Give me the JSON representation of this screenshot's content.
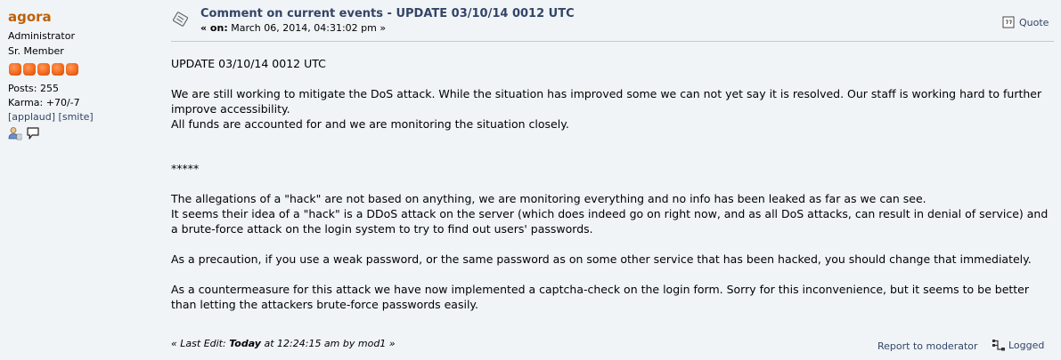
{
  "poster": {
    "name": "agora",
    "title": "Administrator",
    "rank": "Sr. Member",
    "star_count": 5,
    "star_color": "#f26a1d",
    "posts": "Posts: 255",
    "karma": "Karma: +70/-7",
    "applaud": "[applaud]",
    "smite": "[smite]",
    "icons": [
      "profile-icon",
      "personal-message-icon"
    ]
  },
  "post": {
    "subject": "Comment on current events - UPDATE 03/10/14 0012 UTC",
    "date_prefix": "« on:",
    "date_value": "March 06, 2014, 04:31:02 pm »",
    "quote_label": "Quote",
    "body": {
      "p1": "UPDATE 03/10/14 0012 UTC",
      "p2a": "We are still working to mitigate the DoS attack. While the situation has improved some we can not yet say it is resolved. Our staff is working hard to further improve accessibility.",
      "p2b": "All funds are accounted for and we are monitoring the situation closely.",
      "sep": "*****",
      "p3a": "The allegations of a \"hack\" are not based on anything, we are monitoring everything and no info has been leaked as far as we can see.",
      "p3b": "It seems their idea of a \"hack\" is a DDoS attack on the server (which does indeed go on right now, and as all DoS attacks, can result in denial of service) and a brute-force attack on the login system to try to find out users' passwords.",
      "p4": "As a precaution, if you use a weak password, or the same password as on some other service that has been hacked, you should change that immediately.",
      "p5": "As a countermeasure for this attack we have now implemented a captcha-check on the login form. Sorry for this inconvenience, but it seems to be better than letting the attackers brute-force passwords easily."
    },
    "last_edit": {
      "prefix": "« Last Edit:",
      "day": "Today",
      "time": "at 12:24:15 am by mod1 »"
    },
    "report_label": "Report to moderator",
    "logged_label": "Logged"
  },
  "colors": {
    "background": "#f0f4f7",
    "username": "#c06002",
    "link": "#334466"
  }
}
